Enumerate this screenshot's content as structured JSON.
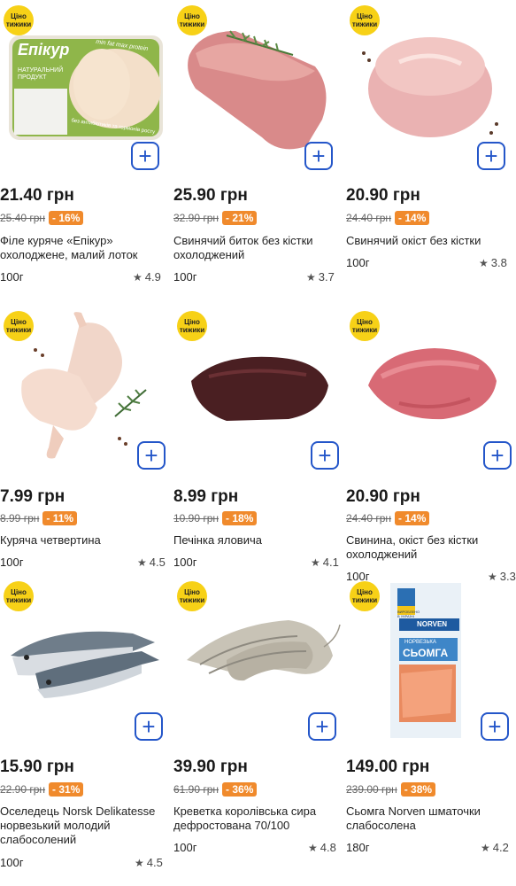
{
  "badge": {
    "line1": "Ціно",
    "line2": "тижики"
  },
  "add_label": "+",
  "colors": {
    "accent": "#2456c9",
    "badge": "#f7d117",
    "discount": "#f08a2c"
  },
  "products": [
    {
      "price": "21.40 грн",
      "old_price": "25.40 грн",
      "discount": "- 16%",
      "name": "Філе куряче «Епікур» охолоджене, малий лоток",
      "weight": "100г",
      "rating": "4.9",
      "pack": {
        "brand": "Епікур",
        "line": "НАТУРАЛЬНИЙ ПРОДУКТ",
        "slogan": "min fat max protein",
        "note": "без антибіотиків та гормонів росту"
      }
    },
    {
      "price": "25.90 грн",
      "old_price": "32.90 грн",
      "discount": "- 21%",
      "name": "Свинячий биток без кістки охолоджений",
      "weight": "100г",
      "rating": "3.7"
    },
    {
      "price": "20.90 грн",
      "old_price": "24.40 грн",
      "discount": "- 14%",
      "name": "Свинячий окіст без кістки",
      "weight": "100г",
      "rating": "3.8"
    },
    {
      "price": "7.99 грн",
      "old_price": "8.99 грн",
      "discount": "- 11%",
      "name": "Куряча четвертина",
      "weight": "100г",
      "rating": "4.5"
    },
    {
      "price": "8.99 грн",
      "old_price": "10.90 грн",
      "discount": "- 18%",
      "name": "Печінка яловича",
      "weight": "100г",
      "rating": "4.1"
    },
    {
      "price": "20.90 грн",
      "old_price": "24.40 грн",
      "discount": "- 14%",
      "name": "Свинина, окіст без кістки охолоджений",
      "weight": "100г",
      "rating": "3.3"
    },
    {
      "price": "15.90 грн",
      "old_price": "22.90 грн",
      "discount": "- 31%",
      "name": "Оселедець Norsk Delikatesse норвезький молодий слабосолений",
      "weight": "100г",
      "rating": "4.5"
    },
    {
      "price": "39.90 грн",
      "old_price": "61.90 грн",
      "discount": "- 36%",
      "name": "Креветка королівська сира дефростована 70/100",
      "weight": "100г",
      "rating": "4.8"
    },
    {
      "price": "149.00 грн",
      "old_price": "239.00 грн",
      "discount": "- 38%",
      "name": "Сьомга Norven шматочки слабосолена",
      "weight": "180г",
      "rating": "4.2",
      "pack": {
        "brand": "NORVEN",
        "title": "СЬОМГА",
        "line": "НОРВЕЗЬКА",
        "origin": "ВИРОБЛЕНО В УКРАЇНІ"
      }
    }
  ]
}
